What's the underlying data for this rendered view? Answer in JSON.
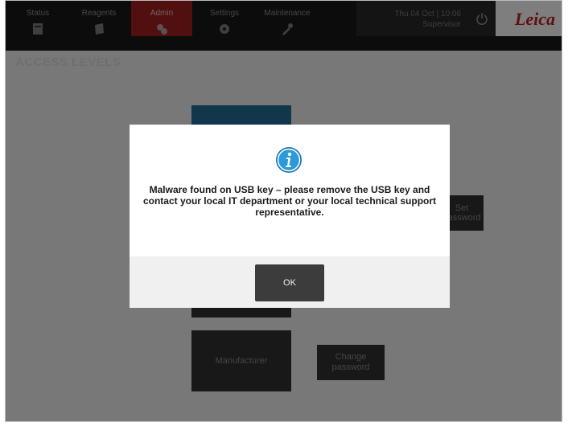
{
  "nav": {
    "tabs": [
      {
        "label": "Status",
        "icon": "status-icon"
      },
      {
        "label": "Reagents",
        "icon": "reagents-icon"
      },
      {
        "label": "Admin",
        "icon": "admin-icon",
        "active": true
      },
      {
        "label": "Settings",
        "icon": "settings-icon"
      },
      {
        "label": "Maintenance",
        "icon": "maintenance-icon"
      }
    ],
    "datetime_line1": "Thu 04 Oct | 10:06",
    "datetime_line2": "Supervisor",
    "power_icon": "power-icon",
    "logo": "Leica"
  },
  "page": {
    "title": "ACCESS LEVELS"
  },
  "tiles": {
    "change_password_right": "Set password",
    "manufacturer": "Manufacturer",
    "change_password": "Change password"
  },
  "dialog": {
    "icon": "info-icon",
    "message": "Malware found on USB key – please remove the USB key and contact your local IT department or your local technical support representative.",
    "ok_label": "OK"
  },
  "colors": {
    "accent_red": "#8d1a1d",
    "brand": "#a21c1f",
    "info_blue": "#2a9ad8",
    "tile_blue": "#1f5f86"
  }
}
